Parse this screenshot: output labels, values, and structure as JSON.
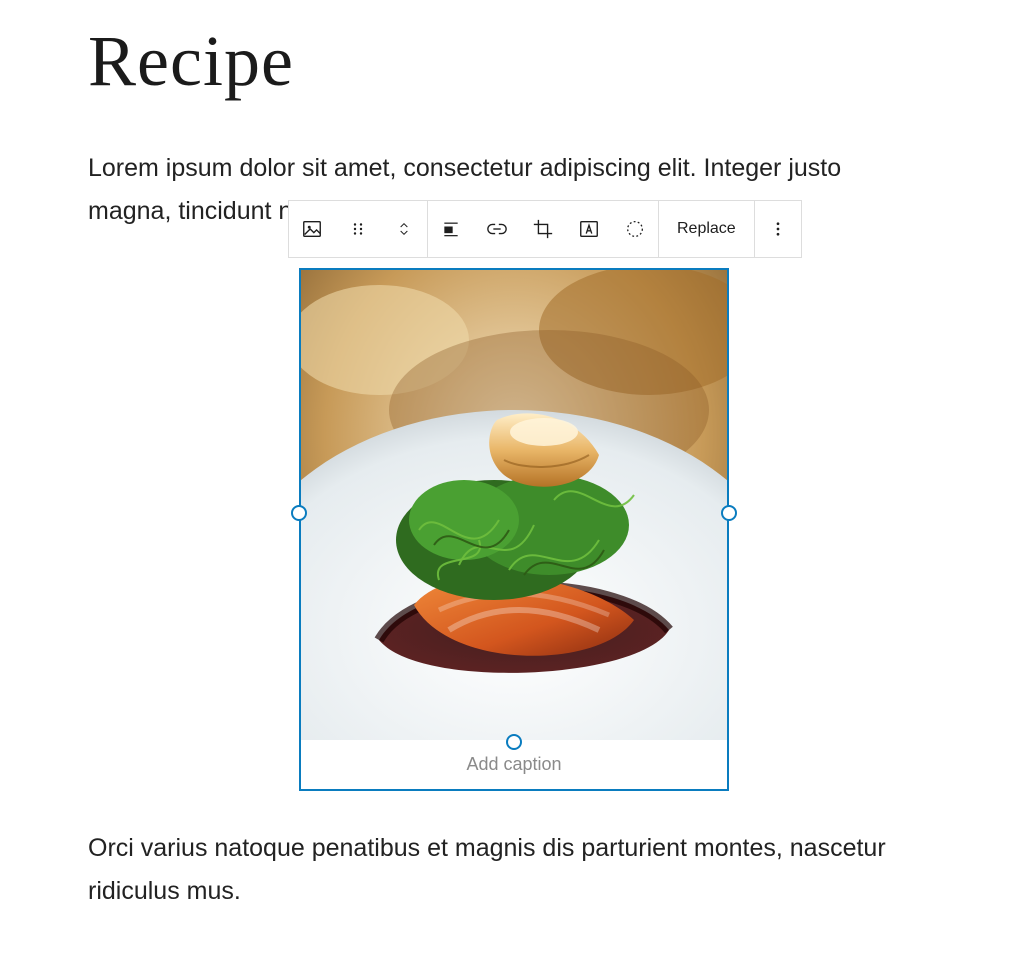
{
  "title": "Recipe",
  "paragraph1": "Lorem ipsum dolor sit amet, consectetur adipiscing elit. Integer justo magna, tincidunt nec commodo non, faucibus a purus.",
  "paragraph2": "Orci varius natoque penatibus et magnis dis parturient montes, nascetur ridiculus mus.",
  "toolbar": {
    "replace_label": "Replace",
    "icons": {
      "image": "image-icon",
      "drag": "drag-icon",
      "move": "move-updown-icon",
      "align": "align-icon",
      "link": "link-icon",
      "crop": "crop-icon",
      "text_overlay": "text-overlay-icon",
      "duotone": "duotone-icon",
      "more": "more-vertical-icon"
    }
  },
  "image_block": {
    "caption_placeholder": "Add caption"
  },
  "colors": {
    "accent": "#0a7cbf"
  }
}
